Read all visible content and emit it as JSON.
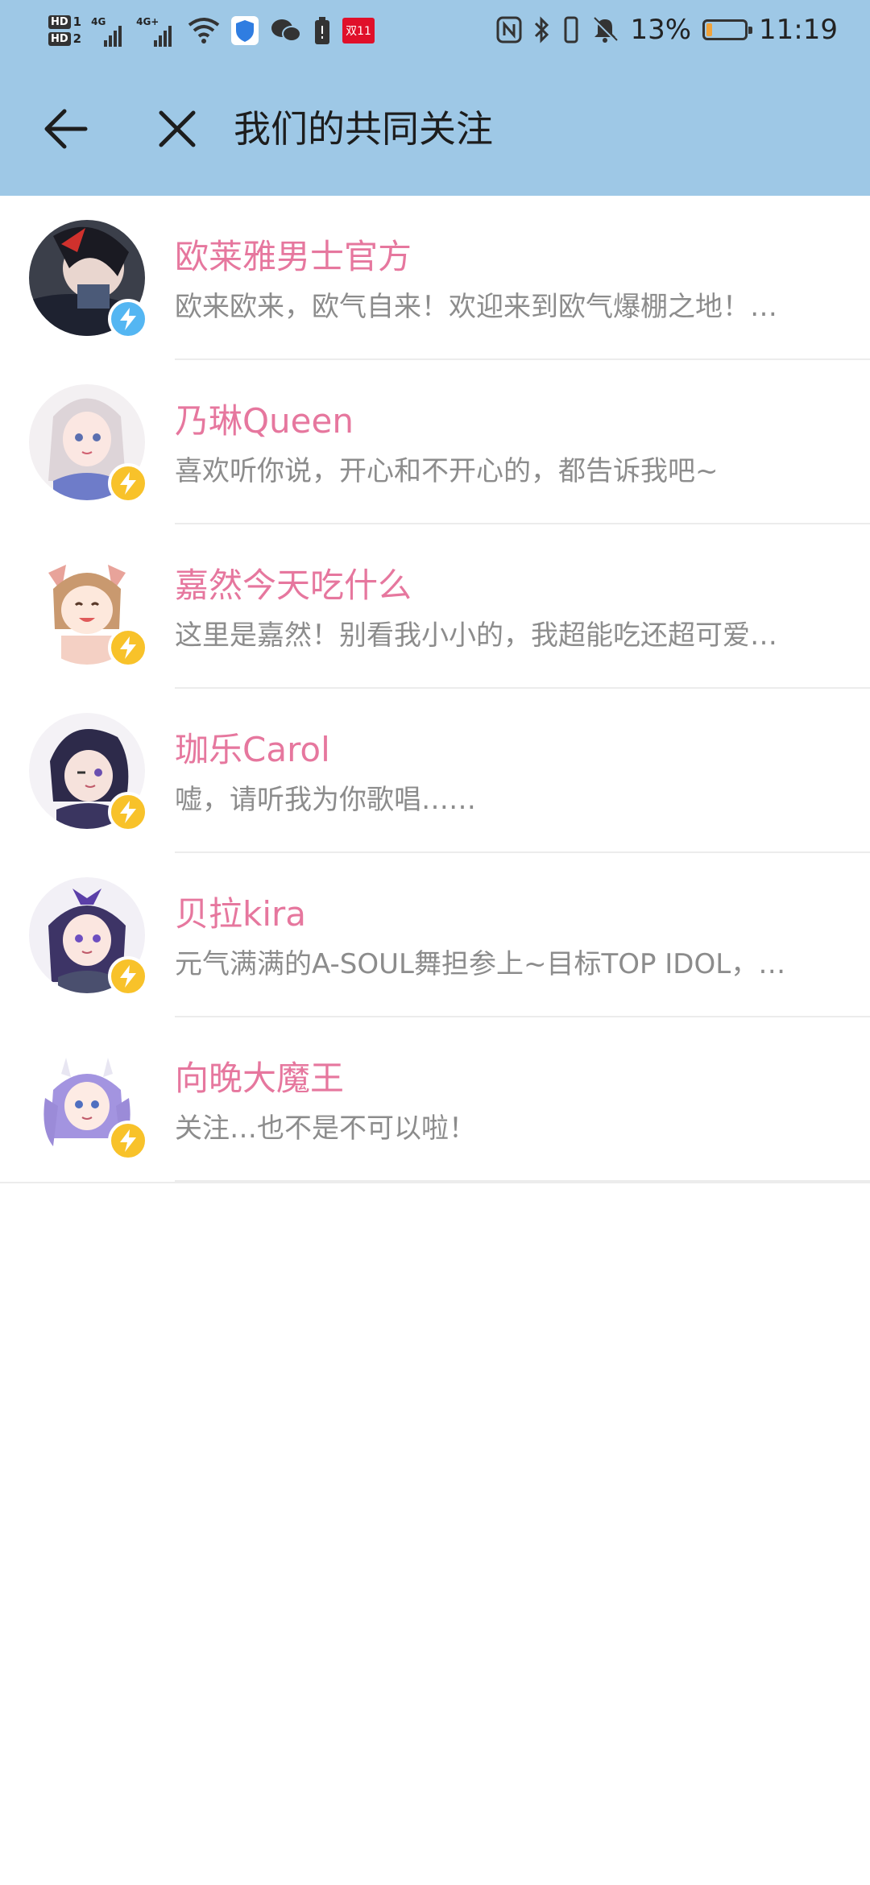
{
  "status_bar": {
    "hd1": "HD",
    "hd1_num": "1",
    "hd2": "HD",
    "hd2_num": "2",
    "sig1_label": "4G",
    "sig2_label": "4G+",
    "promo_badge": "双11",
    "battery_percent": "13%",
    "battery_level": 0.13,
    "time": "11:19",
    "icons": [
      "wifi-icon",
      "shield-icon",
      "wechat-icon",
      "battery-saver-icon",
      "nfc-icon",
      "bluetooth-icon",
      "vibrate-icon",
      "mute-icon"
    ]
  },
  "toolbar": {
    "title": "我们的共同关注",
    "back_icon": "arrow-left-icon",
    "close_icon": "close-icon"
  },
  "colors": {
    "header_bg": "#9ec8e6",
    "name_pink": "#e6779e",
    "desc_gray": "#8c8c8c",
    "badge_blue": "#54b6f2",
    "badge_yellow": "#f8c22a"
  },
  "users": [
    {
      "name": "欧莱雅男士官方",
      "desc": "欧来欧来，欧气自来！欢迎来到欧气爆棚之地！…",
      "badge": "blue"
    },
    {
      "name": "乃琳Queen",
      "desc": "喜欢听你说，开心和不开心的，都告诉我吧~",
      "badge": "yellow"
    },
    {
      "name": "嘉然今天吃什么",
      "desc": "这里是嘉然！别看我小小的，我超能吃还超可爱…",
      "badge": "yellow"
    },
    {
      "name": "珈乐Carol",
      "desc": "嘘，请听我为你歌唱……",
      "badge": "yellow"
    },
    {
      "name": "贝拉kira",
      "desc": "元气满满的A-SOUL舞担参上~目标TOP IDOL，…",
      "badge": "yellow"
    },
    {
      "name": "向晚大魔王",
      "desc": "关注…也不是不可以啦！",
      "badge": "yellow"
    }
  ]
}
